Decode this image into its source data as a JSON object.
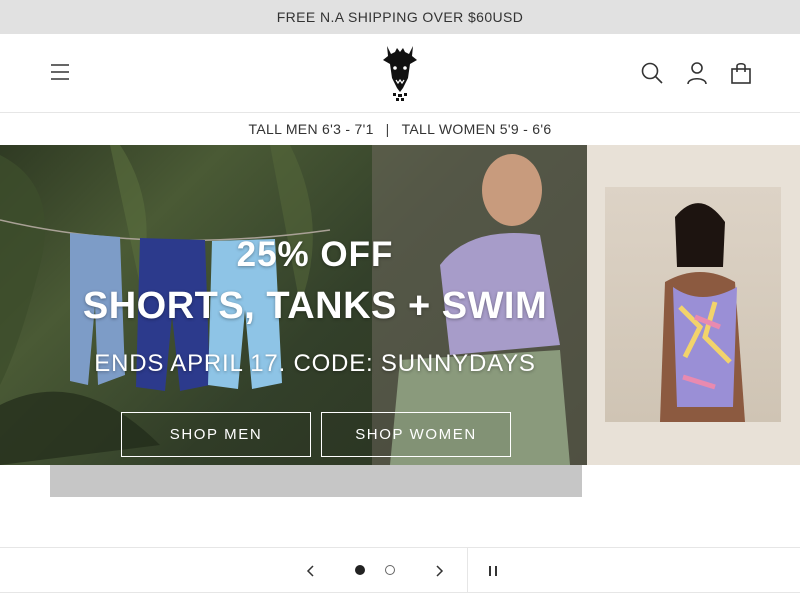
{
  "announcement": {
    "text": "FREE N.A SHIPPING OVER $60USD"
  },
  "header": {
    "menu_icon": "hamburger-menu-icon",
    "logo_icon": "giraffe-logo-icon",
    "search_icon": "search-icon",
    "account_icon": "account-icon",
    "cart_icon": "shopping-bag-icon"
  },
  "subnav": {
    "men_label": "TALL MEN 6'3 - 7'1",
    "separator": "|",
    "women_label": "TALL WOMEN 5'9 - 6'6"
  },
  "hero": {
    "title_line1": "25% OFF",
    "title_line2": "SHORTS, TANKS + SWIM",
    "subtitle": "ENDS APRIL 17. CODE: SUNNYDAYS",
    "shop_men_label": "SHOP MEN",
    "shop_women_label": "SHOP WOMEN"
  },
  "slider": {
    "prev_icon": "chevron-left-icon",
    "next_icon": "chevron-right-icon",
    "pause_icon": "pause-icon",
    "slide_count": 2,
    "active_slide": 1
  },
  "colors": {
    "announcement_bg": "#e1e1e1",
    "hero_right_bg": "#e8e1d7",
    "text_dark": "#222222"
  }
}
